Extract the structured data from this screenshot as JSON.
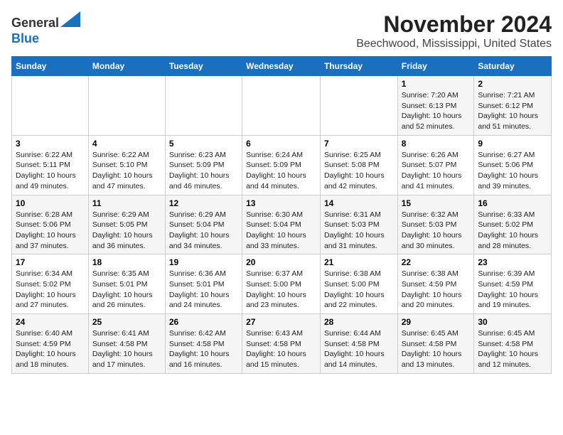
{
  "logo": {
    "general": "General",
    "blue": "Blue"
  },
  "title": "November 2024",
  "subtitle": "Beechwood, Mississippi, United States",
  "days_of_week": [
    "Sunday",
    "Monday",
    "Tuesday",
    "Wednesday",
    "Thursday",
    "Friday",
    "Saturday"
  ],
  "weeks": [
    [
      {
        "day": "",
        "info": ""
      },
      {
        "day": "",
        "info": ""
      },
      {
        "day": "",
        "info": ""
      },
      {
        "day": "",
        "info": ""
      },
      {
        "day": "",
        "info": ""
      },
      {
        "day": "1",
        "info": "Sunrise: 7:20 AM\nSunset: 6:13 PM\nDaylight: 10 hours\nand 52 minutes."
      },
      {
        "day": "2",
        "info": "Sunrise: 7:21 AM\nSunset: 6:12 PM\nDaylight: 10 hours\nand 51 minutes."
      }
    ],
    [
      {
        "day": "3",
        "info": "Sunrise: 6:22 AM\nSunset: 5:11 PM\nDaylight: 10 hours\nand 49 minutes."
      },
      {
        "day": "4",
        "info": "Sunrise: 6:22 AM\nSunset: 5:10 PM\nDaylight: 10 hours\nand 47 minutes."
      },
      {
        "day": "5",
        "info": "Sunrise: 6:23 AM\nSunset: 5:09 PM\nDaylight: 10 hours\nand 46 minutes."
      },
      {
        "day": "6",
        "info": "Sunrise: 6:24 AM\nSunset: 5:09 PM\nDaylight: 10 hours\nand 44 minutes."
      },
      {
        "day": "7",
        "info": "Sunrise: 6:25 AM\nSunset: 5:08 PM\nDaylight: 10 hours\nand 42 minutes."
      },
      {
        "day": "8",
        "info": "Sunrise: 6:26 AM\nSunset: 5:07 PM\nDaylight: 10 hours\nand 41 minutes."
      },
      {
        "day": "9",
        "info": "Sunrise: 6:27 AM\nSunset: 5:06 PM\nDaylight: 10 hours\nand 39 minutes."
      }
    ],
    [
      {
        "day": "10",
        "info": "Sunrise: 6:28 AM\nSunset: 5:06 PM\nDaylight: 10 hours\nand 37 minutes."
      },
      {
        "day": "11",
        "info": "Sunrise: 6:29 AM\nSunset: 5:05 PM\nDaylight: 10 hours\nand 36 minutes."
      },
      {
        "day": "12",
        "info": "Sunrise: 6:29 AM\nSunset: 5:04 PM\nDaylight: 10 hours\nand 34 minutes."
      },
      {
        "day": "13",
        "info": "Sunrise: 6:30 AM\nSunset: 5:04 PM\nDaylight: 10 hours\nand 33 minutes."
      },
      {
        "day": "14",
        "info": "Sunrise: 6:31 AM\nSunset: 5:03 PM\nDaylight: 10 hours\nand 31 minutes."
      },
      {
        "day": "15",
        "info": "Sunrise: 6:32 AM\nSunset: 5:03 PM\nDaylight: 10 hours\nand 30 minutes."
      },
      {
        "day": "16",
        "info": "Sunrise: 6:33 AM\nSunset: 5:02 PM\nDaylight: 10 hours\nand 28 minutes."
      }
    ],
    [
      {
        "day": "17",
        "info": "Sunrise: 6:34 AM\nSunset: 5:02 PM\nDaylight: 10 hours\nand 27 minutes."
      },
      {
        "day": "18",
        "info": "Sunrise: 6:35 AM\nSunset: 5:01 PM\nDaylight: 10 hours\nand 26 minutes."
      },
      {
        "day": "19",
        "info": "Sunrise: 6:36 AM\nSunset: 5:01 PM\nDaylight: 10 hours\nand 24 minutes."
      },
      {
        "day": "20",
        "info": "Sunrise: 6:37 AM\nSunset: 5:00 PM\nDaylight: 10 hours\nand 23 minutes."
      },
      {
        "day": "21",
        "info": "Sunrise: 6:38 AM\nSunset: 5:00 PM\nDaylight: 10 hours\nand 22 minutes."
      },
      {
        "day": "22",
        "info": "Sunrise: 6:38 AM\nSunset: 4:59 PM\nDaylight: 10 hours\nand 20 minutes."
      },
      {
        "day": "23",
        "info": "Sunrise: 6:39 AM\nSunset: 4:59 PM\nDaylight: 10 hours\nand 19 minutes."
      }
    ],
    [
      {
        "day": "24",
        "info": "Sunrise: 6:40 AM\nSunset: 4:59 PM\nDaylight: 10 hours\nand 18 minutes."
      },
      {
        "day": "25",
        "info": "Sunrise: 6:41 AM\nSunset: 4:58 PM\nDaylight: 10 hours\nand 17 minutes."
      },
      {
        "day": "26",
        "info": "Sunrise: 6:42 AM\nSunset: 4:58 PM\nDaylight: 10 hours\nand 16 minutes."
      },
      {
        "day": "27",
        "info": "Sunrise: 6:43 AM\nSunset: 4:58 PM\nDaylight: 10 hours\nand 15 minutes."
      },
      {
        "day": "28",
        "info": "Sunrise: 6:44 AM\nSunset: 4:58 PM\nDaylight: 10 hours\nand 14 minutes."
      },
      {
        "day": "29",
        "info": "Sunrise: 6:45 AM\nSunset: 4:58 PM\nDaylight: 10 hours\nand 13 minutes."
      },
      {
        "day": "30",
        "info": "Sunrise: 6:45 AM\nSunset: 4:58 PM\nDaylight: 10 hours\nand 12 minutes."
      }
    ]
  ]
}
